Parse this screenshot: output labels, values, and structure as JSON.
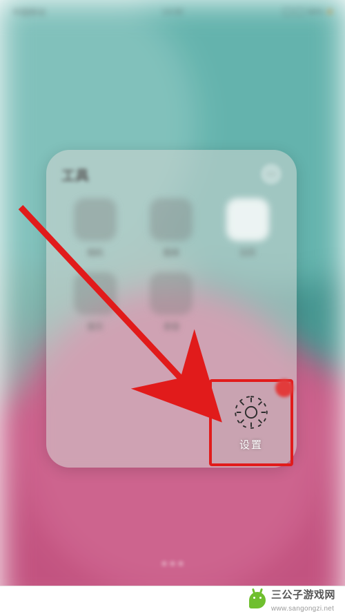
{
  "statusbar": {
    "left": "中国移动",
    "center": "14:08",
    "right": "58%"
  },
  "folder": {
    "title": "工具",
    "apps": [
      {
        "label": "相机",
        "icon": "camera-icon"
      },
      {
        "label": "图库",
        "icon": "gallery-icon"
      },
      {
        "label": "日历",
        "icon": "calendar-icon",
        "white": true
      },
      {
        "label": "音乐",
        "icon": "music-icon"
      },
      {
        "label": "录音",
        "icon": "recorder-icon"
      },
      {
        "label": "设置",
        "icon": "gear-icon"
      }
    ]
  },
  "highlight": {
    "label": "设置",
    "color": "#e11b1b"
  },
  "watermark": {
    "text": "三公子游戏网",
    "url": "www.sangongzi.net"
  }
}
